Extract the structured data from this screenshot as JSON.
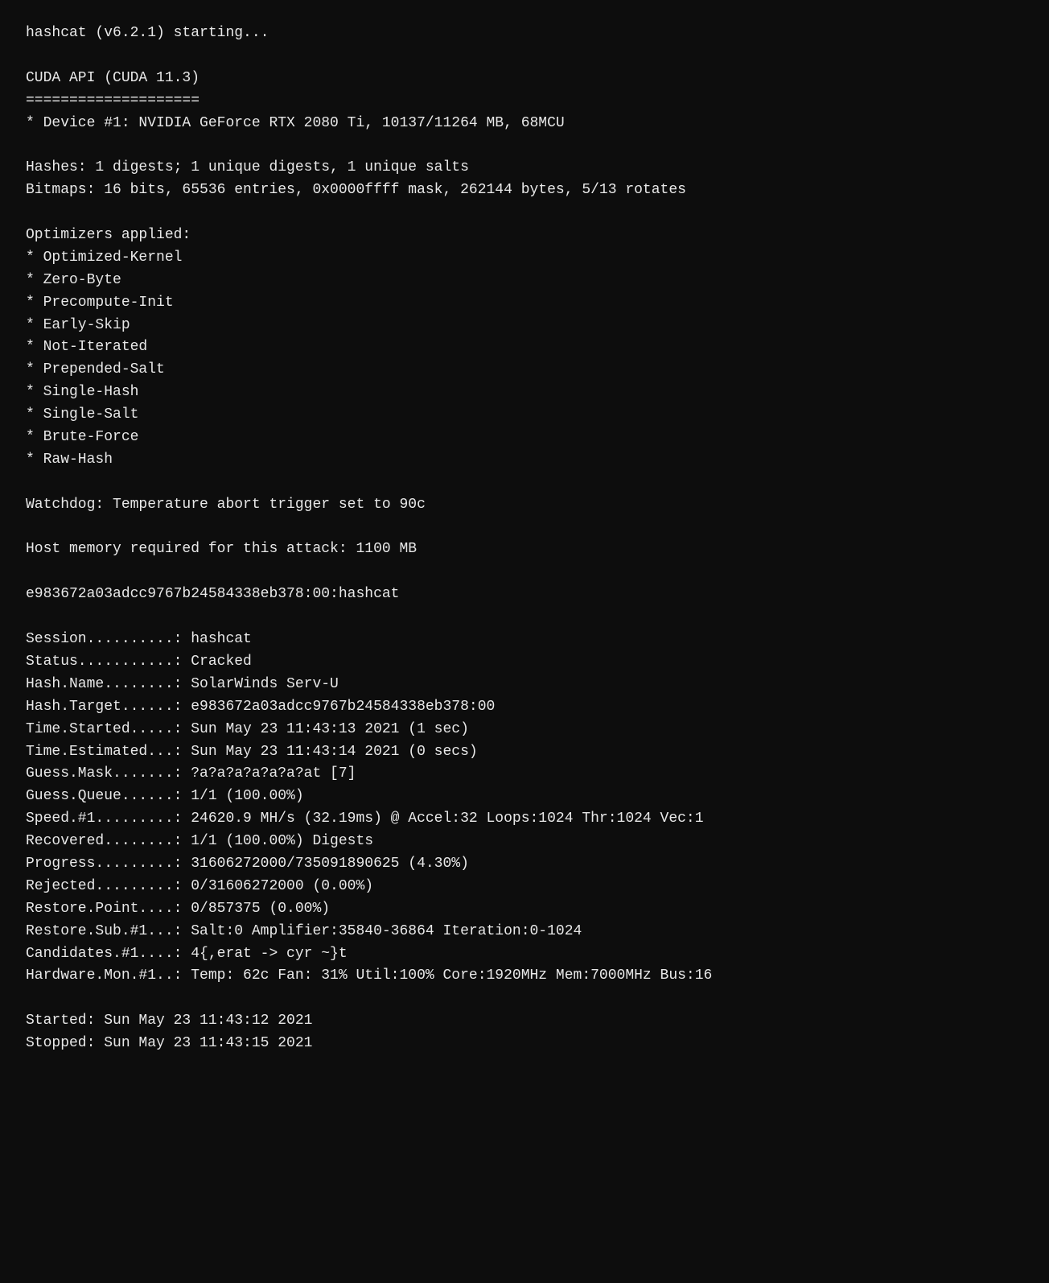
{
  "terminal": {
    "content": "hashcat (v6.2.1) starting...\n\nCUDA API (CUDA 11.3)\n====================\n* Device #1: NVIDIA GeForce RTX 2080 Ti, 10137/11264 MB, 68MCU\n\nHashes: 1 digests; 1 unique digests, 1 unique salts\nBitmaps: 16 bits, 65536 entries, 0x0000ffff mask, 262144 bytes, 5/13 rotates\n\nOptimizers applied:\n* Optimized-Kernel\n* Zero-Byte\n* Precompute-Init\n* Early-Skip\n* Not-Iterated\n* Prepended-Salt\n* Single-Hash\n* Single-Salt\n* Brute-Force\n* Raw-Hash\n\nWatchdog: Temperature abort trigger set to 90c\n\nHost memory required for this attack: 1100 MB\n\ne983672a03adcc9767b24584338eb378:00:hashcat\n\nSession..........: hashcat\nStatus...........: Cracked\nHash.Name........: SolarWinds Serv-U\nHash.Target......: e983672a03adcc9767b24584338eb378:00\nTime.Started.....: Sun May 23 11:43:13 2021 (1 sec)\nTime.Estimated...: Sun May 23 11:43:14 2021 (0 secs)\nGuess.Mask.......: ?a?a?a?a?a?a?at [7]\nGuess.Queue......: 1/1 (100.00%)\nSpeed.#1.........: 24620.9 MH/s (32.19ms) @ Accel:32 Loops:1024 Thr:1024 Vec:1\nRecovered........: 1/1 (100.00%) Digests\nProgress.........: 31606272000/735091890625 (4.30%)\nRejected.........: 0/31606272000 (0.00%)\nRestore.Point....: 0/857375 (0.00%)\nRestore.Sub.#1...: Salt:0 Amplifier:35840-36864 Iteration:0-1024\nCandidates.#1....: 4{,erat -> cyr ~}t\nHardware.Mon.#1..: Temp: 62c Fan: 31% Util:100% Core:1920MHz Mem:7000MHz Bus:16\n\nStarted: Sun May 23 11:43:12 2021\nStopped: Sun May 23 11:43:15 2021"
  }
}
